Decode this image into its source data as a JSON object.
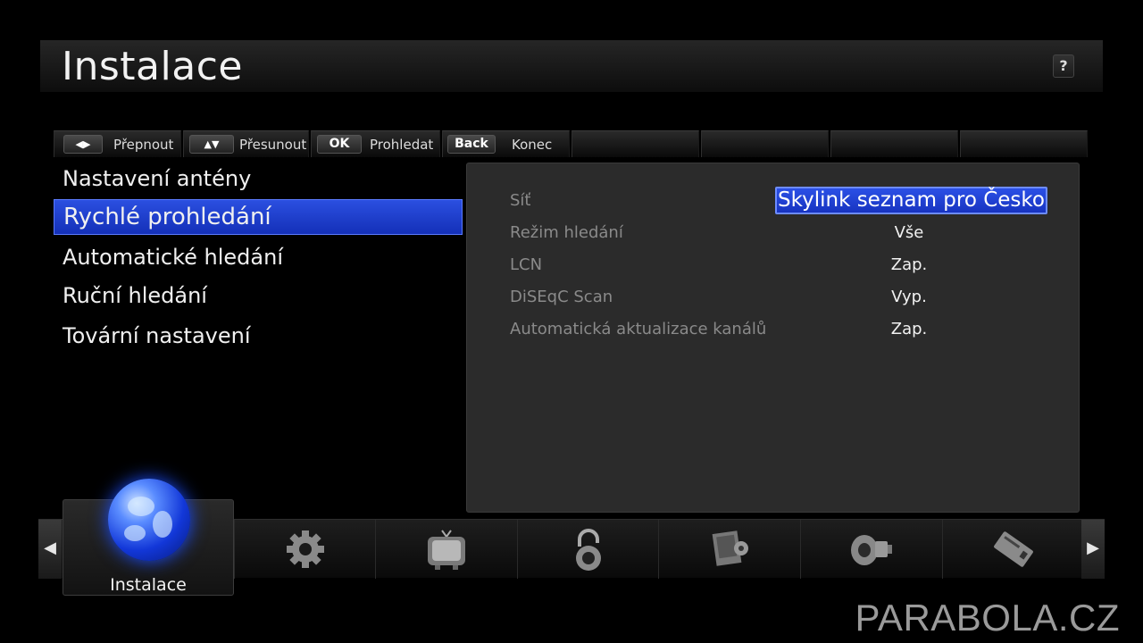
{
  "header": {
    "title": "Instalace",
    "help_label": "?"
  },
  "hints": [
    {
      "key": "◀▶",
      "label": "Přepnout"
    },
    {
      "key": "▲▼",
      "label": "Přesunout"
    },
    {
      "key": "OK",
      "label": "Prohledat"
    },
    {
      "key": "Back",
      "label": "Konec"
    }
  ],
  "menu": {
    "items": [
      {
        "label": "Nastavení antény",
        "selected": false
      },
      {
        "label": "Rychlé prohledání",
        "selected": true
      },
      {
        "label": "Automatické hledání",
        "selected": false
      },
      {
        "label": "Ruční hledání",
        "selected": false
      },
      {
        "label": "Tovární nastavení",
        "selected": false
      }
    ]
  },
  "settings": [
    {
      "label": "Síť",
      "value": "Skylink seznam pro Česko",
      "selected": true
    },
    {
      "label": "Režim hledání",
      "value": "Vše",
      "selected": false
    },
    {
      "label": "LCN",
      "value": "Zap.",
      "selected": false
    },
    {
      "label": "DiSEqC Scan",
      "value": "Vyp.",
      "selected": false
    },
    {
      "label": "Automatická aktualizace kanálů",
      "value": "Zap.",
      "selected": false
    }
  ],
  "dock": {
    "active_label": "Instalace",
    "left_arrow": "◀",
    "right_arrow": "▶",
    "icons": [
      "gear-icon",
      "tv-icon",
      "padlock-icon",
      "notebook-icon",
      "media-icon",
      "card-icon"
    ]
  },
  "colors": {
    "accent": "#1f3fd8",
    "panel": "#2b2b2b",
    "label_gray": "#8a8a8a"
  },
  "watermark": "PARABOLA.CZ"
}
